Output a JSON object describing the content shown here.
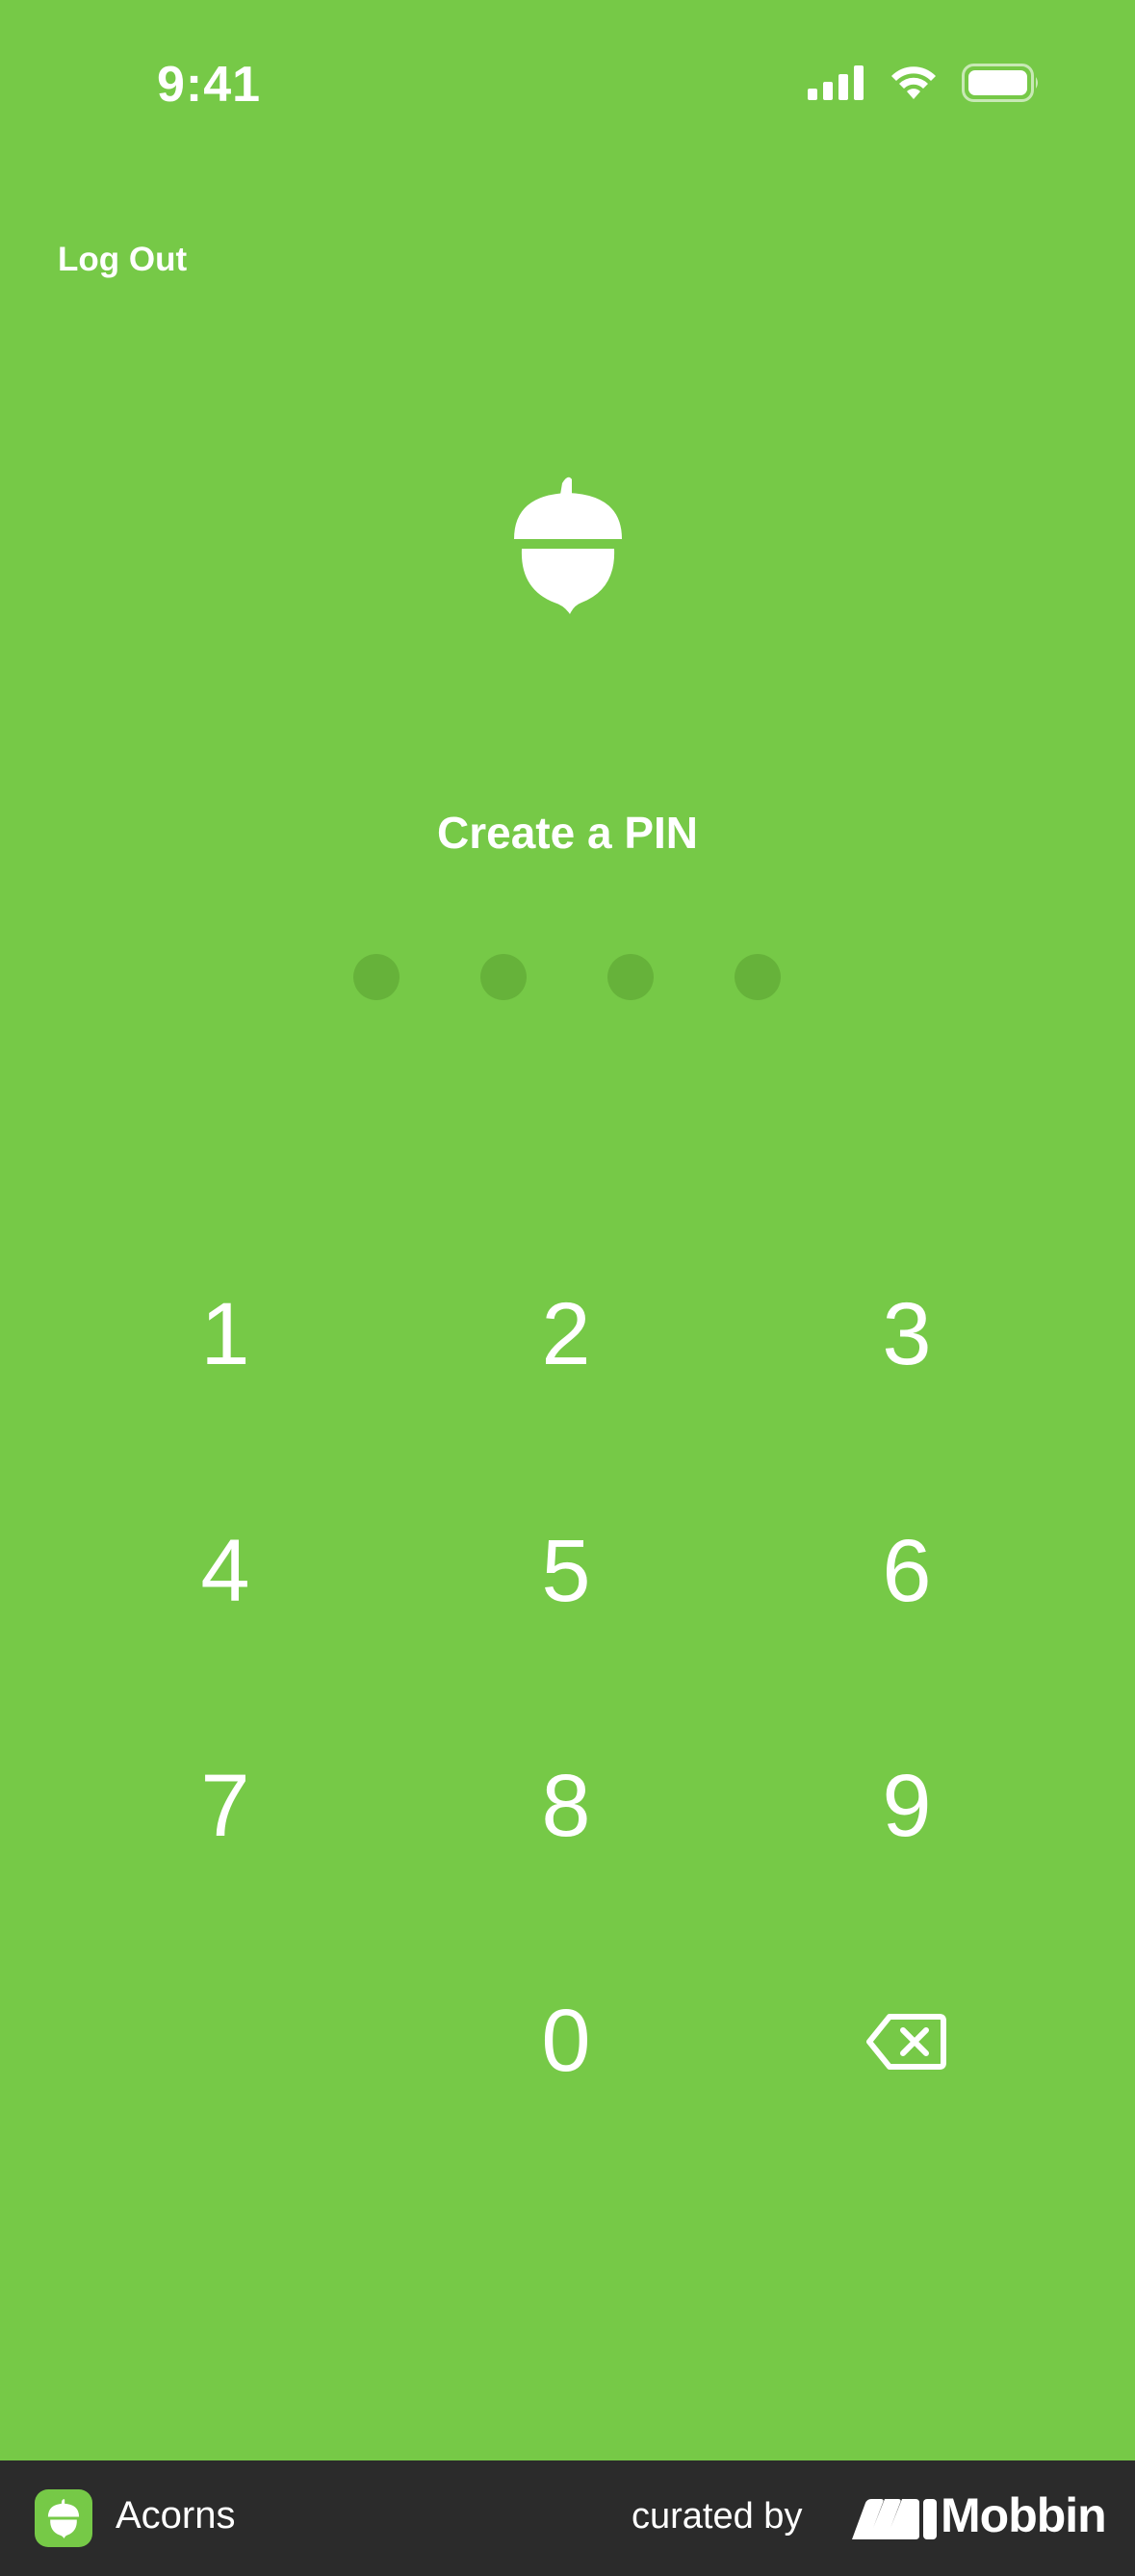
{
  "status_bar": {
    "time": "9:41",
    "icons": [
      "signal-icon",
      "wifi-icon",
      "battery-icon"
    ]
  },
  "header": {
    "logout_label": "Log Out"
  },
  "logo": {
    "icon": "acorn-icon"
  },
  "pin": {
    "title": "Create a PIN",
    "length": 4,
    "entered": 0
  },
  "keypad": {
    "keys": [
      "1",
      "2",
      "3",
      "4",
      "5",
      "6",
      "7",
      "8",
      "9",
      "0"
    ],
    "delete_icon": "backspace-icon"
  },
  "footer": {
    "app_name": "Acorns",
    "curated_by": "curated by",
    "brand": "Mobbin"
  },
  "colors": {
    "background": "#76c947",
    "pin_dot_empty": "#66b23a",
    "text": "#ffffff",
    "footer_background": "#2b2b2b"
  }
}
